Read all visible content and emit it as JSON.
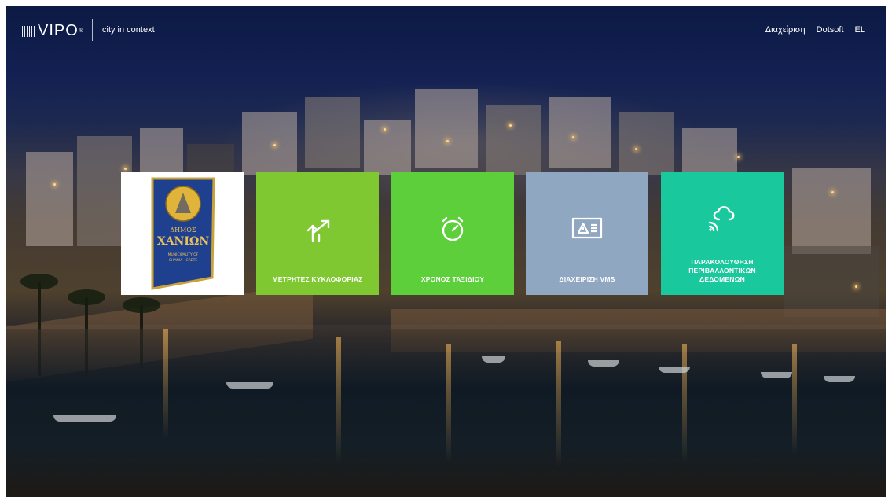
{
  "header": {
    "brand": "VIPO",
    "brand_sup": "®",
    "tagline": "city in context",
    "nav": [
      "Διαχείριση",
      "Dotsoft",
      "EL"
    ]
  },
  "logo_tile": {
    "crest_title": "ΔΗΜΟΣ",
    "crest_name": "ΧΑΝΙΩΝ",
    "crest_sub1": "MUNICIPALITY OF",
    "crest_sub2": "CHANIA · CRETE"
  },
  "tiles": [
    {
      "label": "ΜΕΤΡΗΤΕΣ ΚΥΚΛΟΦΟΡΙΑΣ",
      "icon": "traffic-arrows-icon",
      "color": "#7fc832"
    },
    {
      "label": "ΧΡΟΝΟΣ ΤΑΞΙΔΙΟΥ",
      "icon": "stopwatch-icon",
      "color": "#5ccf3a"
    },
    {
      "label": "ΔΙΑΧΕΙΡΙΣΗ VMS",
      "icon": "vms-sign-icon",
      "color": "#8fa7c1"
    },
    {
      "label": "ΠΑΡΑΚΟΛΟΥΘΗΣΗ ΠΕΡΙΒΑΛΛΟΝΤΙΚΩΝ ΔΕΔΟΜΕΝΩΝ",
      "icon": "cloud-sensor-icon",
      "color": "#19c89c"
    }
  ]
}
